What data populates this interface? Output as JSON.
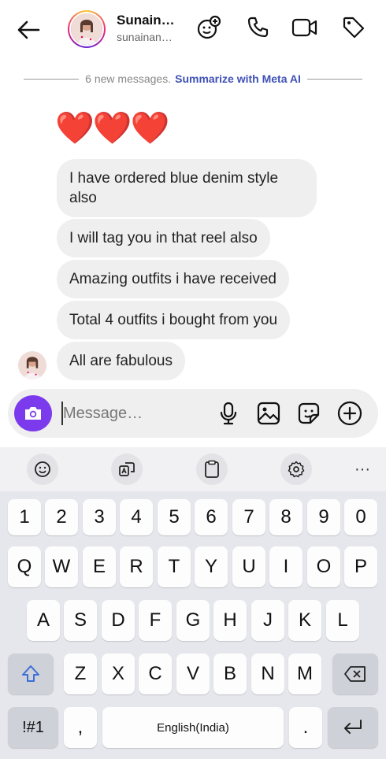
{
  "header": {
    "name": "Sunain…",
    "username": "sunainan…",
    "icons": [
      "back-arrow-icon",
      "avatar",
      "face-add-icon",
      "phone-icon",
      "video-icon",
      "tag-icon"
    ]
  },
  "divider": {
    "text": "6 new messages.",
    "link": "Summarize with Meta AI"
  },
  "messages": {
    "hearts": "❤️❤️❤️",
    "m1": "I have ordered blue denim style also",
    "m2": "I will tag you in that reel also",
    "m3": "Amazing outfits i have received",
    "m4": "Total 4 outfits i bought from you",
    "m5": "All are fabulous"
  },
  "composer": {
    "placeholder": "Message…",
    "icons": [
      "camera-icon",
      "microphone-icon",
      "gallery-icon",
      "sticker-icon",
      "plus-icon"
    ]
  },
  "keyboard": {
    "toolbar_icons": [
      "emoji-icon",
      "translate-icon",
      "clipboard-icon",
      "settings-icon",
      "more-icon"
    ],
    "more": "···",
    "row_numbers": [
      "1",
      "2",
      "3",
      "4",
      "5",
      "6",
      "7",
      "8",
      "9",
      "0"
    ],
    "row1": [
      "Q",
      "W",
      "E",
      "R",
      "T",
      "Y",
      "U",
      "I",
      "O",
      "P"
    ],
    "row2": [
      "A",
      "S",
      "D",
      "F",
      "G",
      "H",
      "J",
      "K",
      "L"
    ],
    "row3": [
      "Z",
      "X",
      "C",
      "V",
      "B",
      "N",
      "M"
    ],
    "symbols": "!#1",
    "comma": ",",
    "space": "English(India)",
    "period": "."
  },
  "colors": {
    "accent": "#7c3aed",
    "link": "#3f51b5",
    "bubble": "#efefef"
  }
}
